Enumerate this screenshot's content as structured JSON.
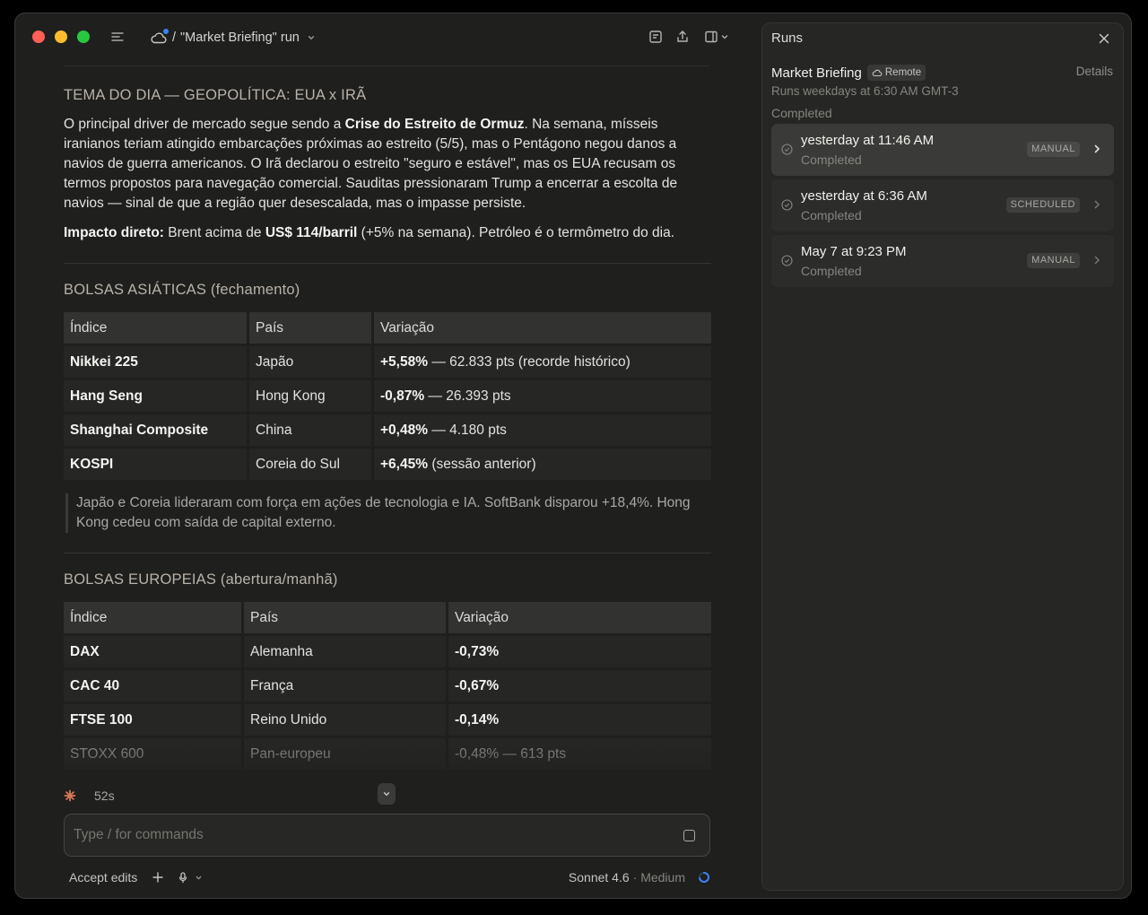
{
  "titlebar": {
    "breadcrumb_sep": "/",
    "run_title": "\"Market Briefing\" run"
  },
  "content": {
    "tema": {
      "heading": "TEMA DO DIA — GEOPOLÍTICA: EUA x IRÃ",
      "p1_a": "O principal driver de mercado segue sendo a ",
      "p1_b": "Crise do Estreito de Ormuz",
      "p1_c": ". Na semana, mísseis iranianos teriam atingido embarcações próximas ao estreito (5/5), mas o Pentágono negou danos a navios de guerra americanos. O Irã declarou o estreito \"seguro e estável\", mas os EUA recusam os termos propostos para navegação comercial. Sauditas pressionaram Trump a encerrar a escolta de navios — sinal de que a região quer desescalada, mas o impasse persiste.",
      "p2_a": "Impacto direto:",
      "p2_b": " Brent acima de ",
      "p2_c": "US$ 114/barril",
      "p2_d": " (+5% na semana). Petróleo é o termômetro do dia."
    },
    "asia": {
      "heading": "BOLSAS ASIÁTICAS (fechamento)",
      "headers": [
        "Índice",
        "País",
        "Variação"
      ],
      "rows": [
        {
          "index": "Nikkei 225",
          "country": "Japão",
          "change": "+5,58%",
          "detail": " — 62.833 pts (recorde histórico)"
        },
        {
          "index": "Hang Seng",
          "country": "Hong Kong",
          "change": "-0,87%",
          "detail": " — 26.393 pts"
        },
        {
          "index": "Shanghai Composite",
          "country": "China",
          "change": "+0,48%",
          "detail": " — 4.180 pts"
        },
        {
          "index": "KOSPI",
          "country": "Coreia do Sul",
          "change": "+6,45%",
          "detail": " (sessão anterior)"
        }
      ],
      "note": "Japão e Coreia lideraram com força em ações de tecnologia e IA. SoftBank disparou +18,4%. Hong Kong cedeu com saída de capital externo."
    },
    "europe": {
      "heading": "BOLSAS EUROPEIAS (abertura/manhã)",
      "headers": [
        "Índice",
        "País",
        "Variação"
      ],
      "rows": [
        {
          "index": "DAX",
          "country": "Alemanha",
          "change": "-0,73%",
          "detail": ""
        },
        {
          "index": "CAC 40",
          "country": "França",
          "change": "-0,67%",
          "detail": ""
        },
        {
          "index": "FTSE 100",
          "country": "Reino Unido",
          "change": "-0,14%",
          "detail": ""
        },
        {
          "index": "STOXX 600",
          "country": "Pan-europeu",
          "change": "-0,48%",
          "detail": " — 613 pts"
        }
      ]
    }
  },
  "status": {
    "elapsed": "52s"
  },
  "composer": {
    "placeholder": "Type / for commands"
  },
  "footer": {
    "accept_edits": "Accept edits",
    "model": "Sonnet 4.6",
    "effort": "· Medium"
  },
  "runs_panel": {
    "title": "Runs",
    "schedule_name": "Market Briefing",
    "remote_label": "Remote",
    "details_label": "Details",
    "schedule": "Runs weekdays at 6:30 AM GMT-3",
    "group_label": "Completed",
    "runs": [
      {
        "when": "yesterday at 11:46 AM",
        "state": "Completed",
        "trigger": "MANUAL"
      },
      {
        "when": "yesterday at 6:36 AM",
        "state": "Completed",
        "trigger": "SCHEDULED"
      },
      {
        "when": "May 7 at 9:23 PM",
        "state": "Completed",
        "trigger": "MANUAL"
      }
    ]
  },
  "colors": {
    "window_bg": "#1f1f1e",
    "panel_bg": "#262625",
    "heading_tan": "#b8b3a8",
    "accent_orange": "#d97757",
    "spinner_blue": "#3b82f6"
  },
  "icons": {
    "sidebar_toggle": "sidebar-toggle-icon",
    "cloud": "cloud-icon",
    "notes": "notes-icon",
    "share": "share-icon",
    "panel": "panel-layout-icon",
    "close": "close-icon",
    "check": "check-circle-icon",
    "chevron": "chevron-right-icon"
  }
}
